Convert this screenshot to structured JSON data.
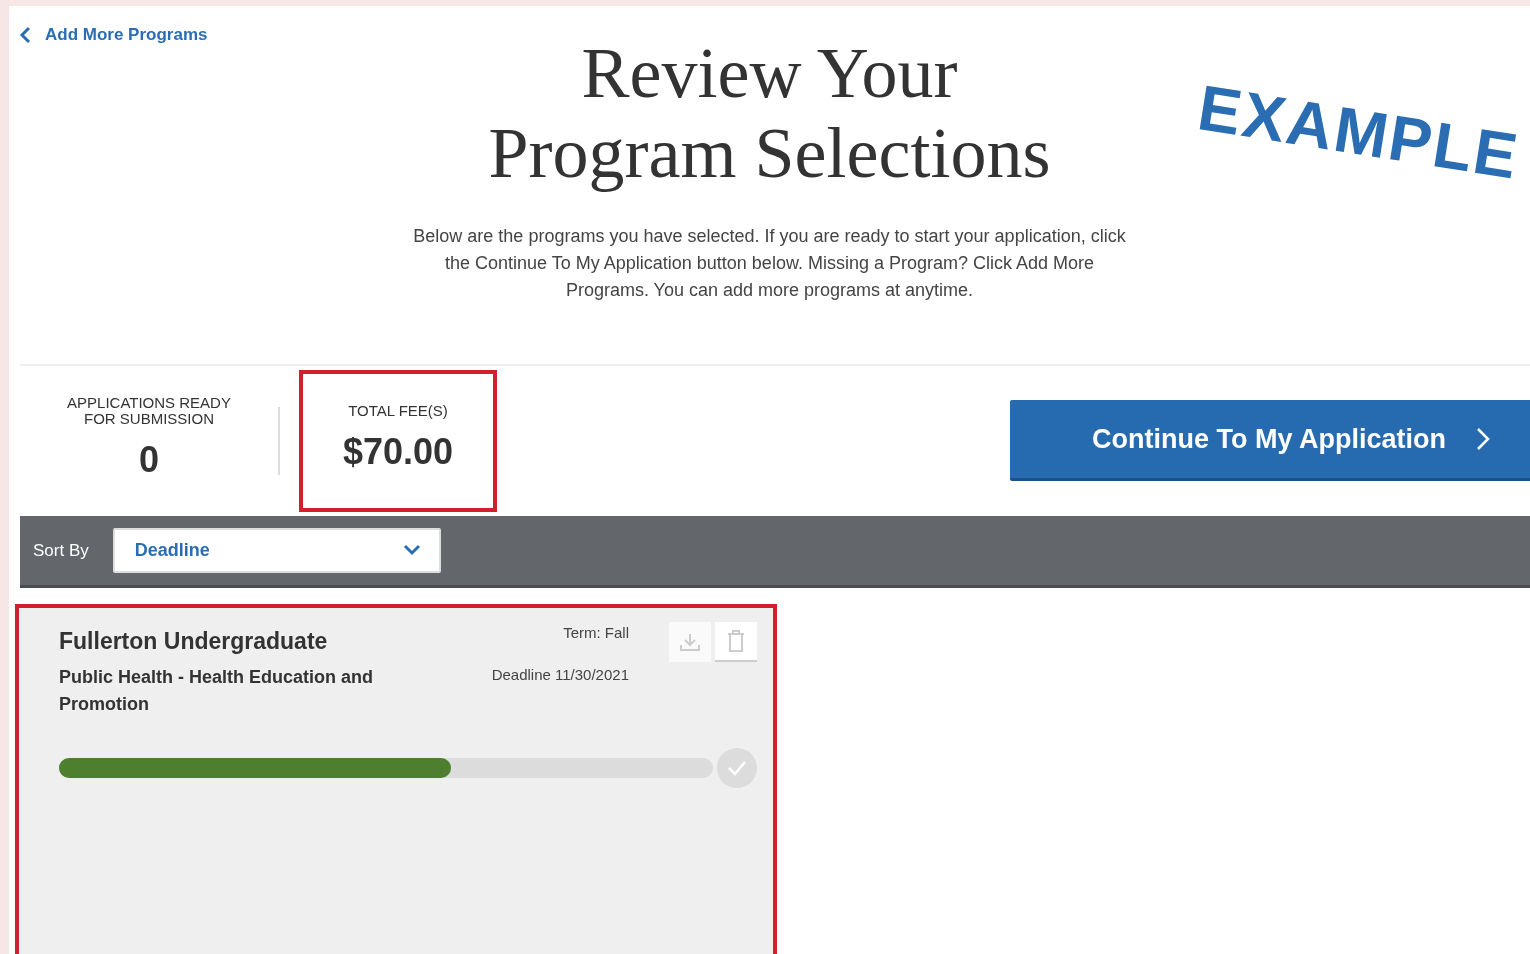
{
  "back_link": {
    "label": "Add More Programs"
  },
  "title": "Review Your Program Selections",
  "description": "Below are the programs you have selected. If you are ready to start your application, click the Continue To My Application button below. Missing a Program? Click Add More Programs. You can add more programs at anytime.",
  "stamp": {
    "text": "EXAMPLE"
  },
  "stats": [
    {
      "label": "APPLICATIONS READY FOR SUBMISSION",
      "value": "0",
      "highlighted": false
    },
    {
      "label": "TOTAL FEE(S)",
      "value": "$70.00",
      "highlighted": true
    }
  ],
  "continue_button": {
    "label": "Continue To My Application"
  },
  "sort": {
    "label": "Sort By",
    "value": "Deadline"
  },
  "programs": [
    {
      "school": "Fullerton Undergraduate",
      "term": "Term: Fall",
      "program": "Public Health - Health Education and Promotion",
      "deadline": "Deadline 11/30/2021",
      "level": 0.6,
      "complete": false,
      "highlighted": true
    }
  ]
}
